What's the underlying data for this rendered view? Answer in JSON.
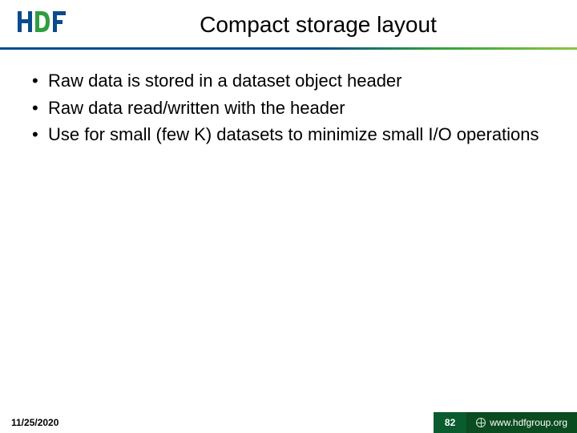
{
  "header": {
    "title": "Compact  storage layout",
    "logo_alt": "HDF"
  },
  "bullets": [
    "Raw data is stored in a dataset object header",
    "Raw data read/written with the header",
    "Use for small (few K) datasets to minimize small I/O operations"
  ],
  "footer": {
    "date": "11/25/2020",
    "page": "82",
    "site": "www.hdfgroup.org"
  },
  "colors": {
    "brand_blue": "#0a4b8c",
    "brand_green": "#2e9e3f",
    "footer_dark": "#0a4b1f"
  }
}
